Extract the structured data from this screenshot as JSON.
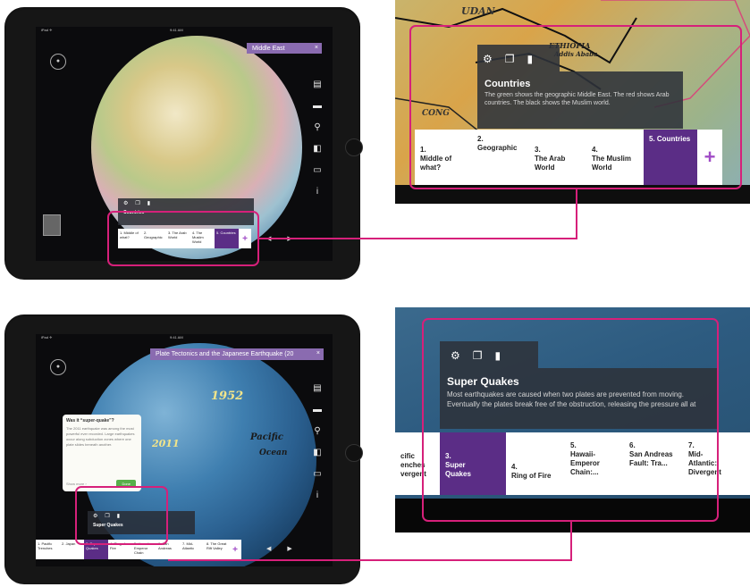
{
  "top": {
    "ipad": {
      "status_left": "iPad ✈",
      "status_center": "9:41 AM",
      "title": "Middle East",
      "side_icons": [
        "list-icon",
        "search-icon",
        "layers-icon",
        "presentation-icon",
        "info-icon"
      ],
      "mini_panel_title": "Countries",
      "mini_tabs": [
        "1. Middle of what?",
        "2. Geographic",
        "3. The Arab World",
        "4. The Muslim World",
        "5. Countries"
      ]
    },
    "zoom": {
      "map_labels": [
        "UDAN",
        "ETHIOPIA",
        "Addis Ababa",
        "CONG"
      ],
      "card_title": "Countries",
      "card_text": "The green shows the geographic Middle East. The red shows Arab countries. The black shows the Muslim world.",
      "tabs": [
        {
          "num": "1.",
          "label": "Middle of what?"
        },
        {
          "num": "2.",
          "label": "Geographic"
        },
        {
          "num": "3.",
          "label": "The Arab World"
        },
        {
          "num": "4.",
          "label": "The Muslim World"
        },
        {
          "num": "5.",
          "label": "Countries"
        }
      ],
      "plus": "+"
    }
  },
  "bottom": {
    "ipad": {
      "status_left": "iPad ✈",
      "status_center": "9:41 AM",
      "title": "Plate Tectonics and the Japanese Earthquake (20",
      "popup_title": "Was it “super-quake”?",
      "popup_body": "The 2011 earthquake was among the most powerful ever recorded. Large earthquakes occur along subduction zones where one plate slides beneath another.",
      "popup_link": "Show more ›",
      "popup_button": "Done",
      "globe_labels": [
        "1952",
        "2011",
        "Pacific",
        "Ocean"
      ],
      "mini_panel_title": "Super Quakes",
      "mini_tabs": [
        "1. Pacific Trenches",
        "2. Japan",
        "3. Super Quakes",
        "4. Ring of Fire",
        "5. Hawaii-Emperor Chain",
        "6. San Andreas",
        "7. Mid-Atlantic",
        "8. The Great Rift Valley"
      ]
    },
    "zoom": {
      "card_title": "Super Quakes",
      "card_text": "Most earthquakes are caused when two plates are prevented from moving. Eventually the plates break free of the obstruction, releasing the pressure all at",
      "tabs": [
        {
          "num": "",
          "label": "cific enches vergent"
        },
        {
          "num": "3.",
          "label": "Super Quakes"
        },
        {
          "num": "4.",
          "label": "Ring of Fire"
        },
        {
          "num": "5.",
          "label": "Hawaii-Emperor Chain:..."
        },
        {
          "num": "6.",
          "label": "San Andreas Fault: Tra..."
        },
        {
          "num": "7.",
          "label": "Mid-Atlantic: Divergent"
        }
      ]
    }
  },
  "colors": {
    "accent": "#d6207a",
    "purple": "#5b2d86",
    "title_bar": "#8a6bb0"
  }
}
